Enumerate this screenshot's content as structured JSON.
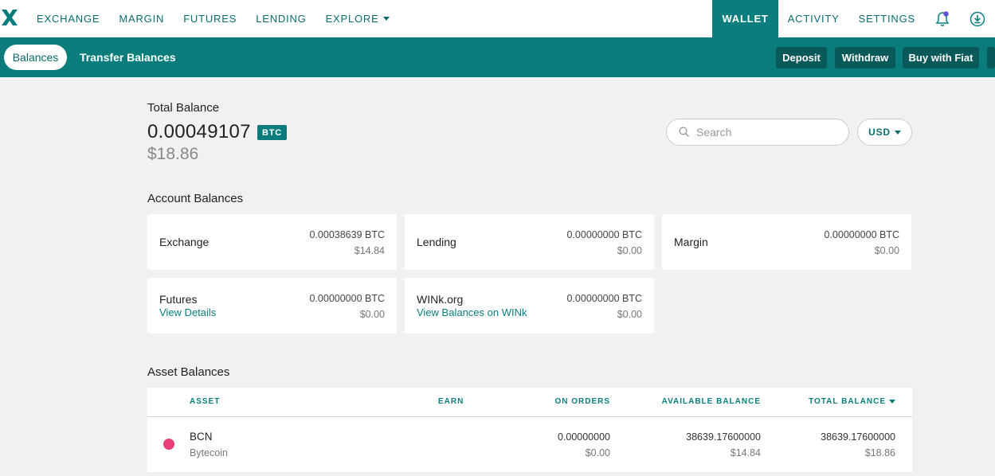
{
  "nav": {
    "links": [
      "EXCHANGE",
      "MARGIN",
      "FUTURES",
      "LENDING",
      "EXPLORE"
    ],
    "right": [
      "WALLET",
      "ACTIVITY",
      "SETTINGS"
    ]
  },
  "subnav": {
    "balances": "Balances",
    "transfer": "Transfer Balances",
    "deposit": "Deposit",
    "withdraw": "Withdraw",
    "buy_fiat": "Buy with Fiat"
  },
  "total": {
    "label": "Total Balance",
    "btc": "0.00049107",
    "badge": "BTC",
    "usd": "$18.86"
  },
  "search": {
    "placeholder": "Search"
  },
  "currency": "USD",
  "account_title": "Account Balances",
  "accounts": [
    {
      "name": "Exchange",
      "btc": "0.00038639 BTC",
      "usd": "$14.84"
    },
    {
      "name": "Lending",
      "btc": "0.00000000 BTC",
      "usd": "$0.00"
    },
    {
      "name": "Margin",
      "btc": "0.00000000 BTC",
      "usd": "$0.00"
    },
    {
      "name": "Futures",
      "link": "View Details",
      "btc": "0.00000000 BTC",
      "usd": "$0.00"
    },
    {
      "name": "WINk.org",
      "link": "View Balances on WINk",
      "btc": "0.00000000 BTC",
      "usd": "$0.00"
    }
  ],
  "asset_title": "Asset Balances",
  "table": {
    "headers": [
      "ASSET",
      "EARN",
      "ON ORDERS",
      "AVAILABLE BALANCE",
      "TOTAL BALANCE"
    ],
    "rows": [
      {
        "symbol": "BCN",
        "name": "Bytecoin",
        "color": "#e8417a",
        "on_orders": "0.00000000",
        "on_orders_usd": "$0.00",
        "available": "38639.17600000",
        "available_usd": "$14.84",
        "total": "38639.17600000",
        "total_usd": "$18.86"
      }
    ]
  },
  "colors": {
    "teal": "#0b7c7c",
    "teal_dark": "#085a5a"
  }
}
